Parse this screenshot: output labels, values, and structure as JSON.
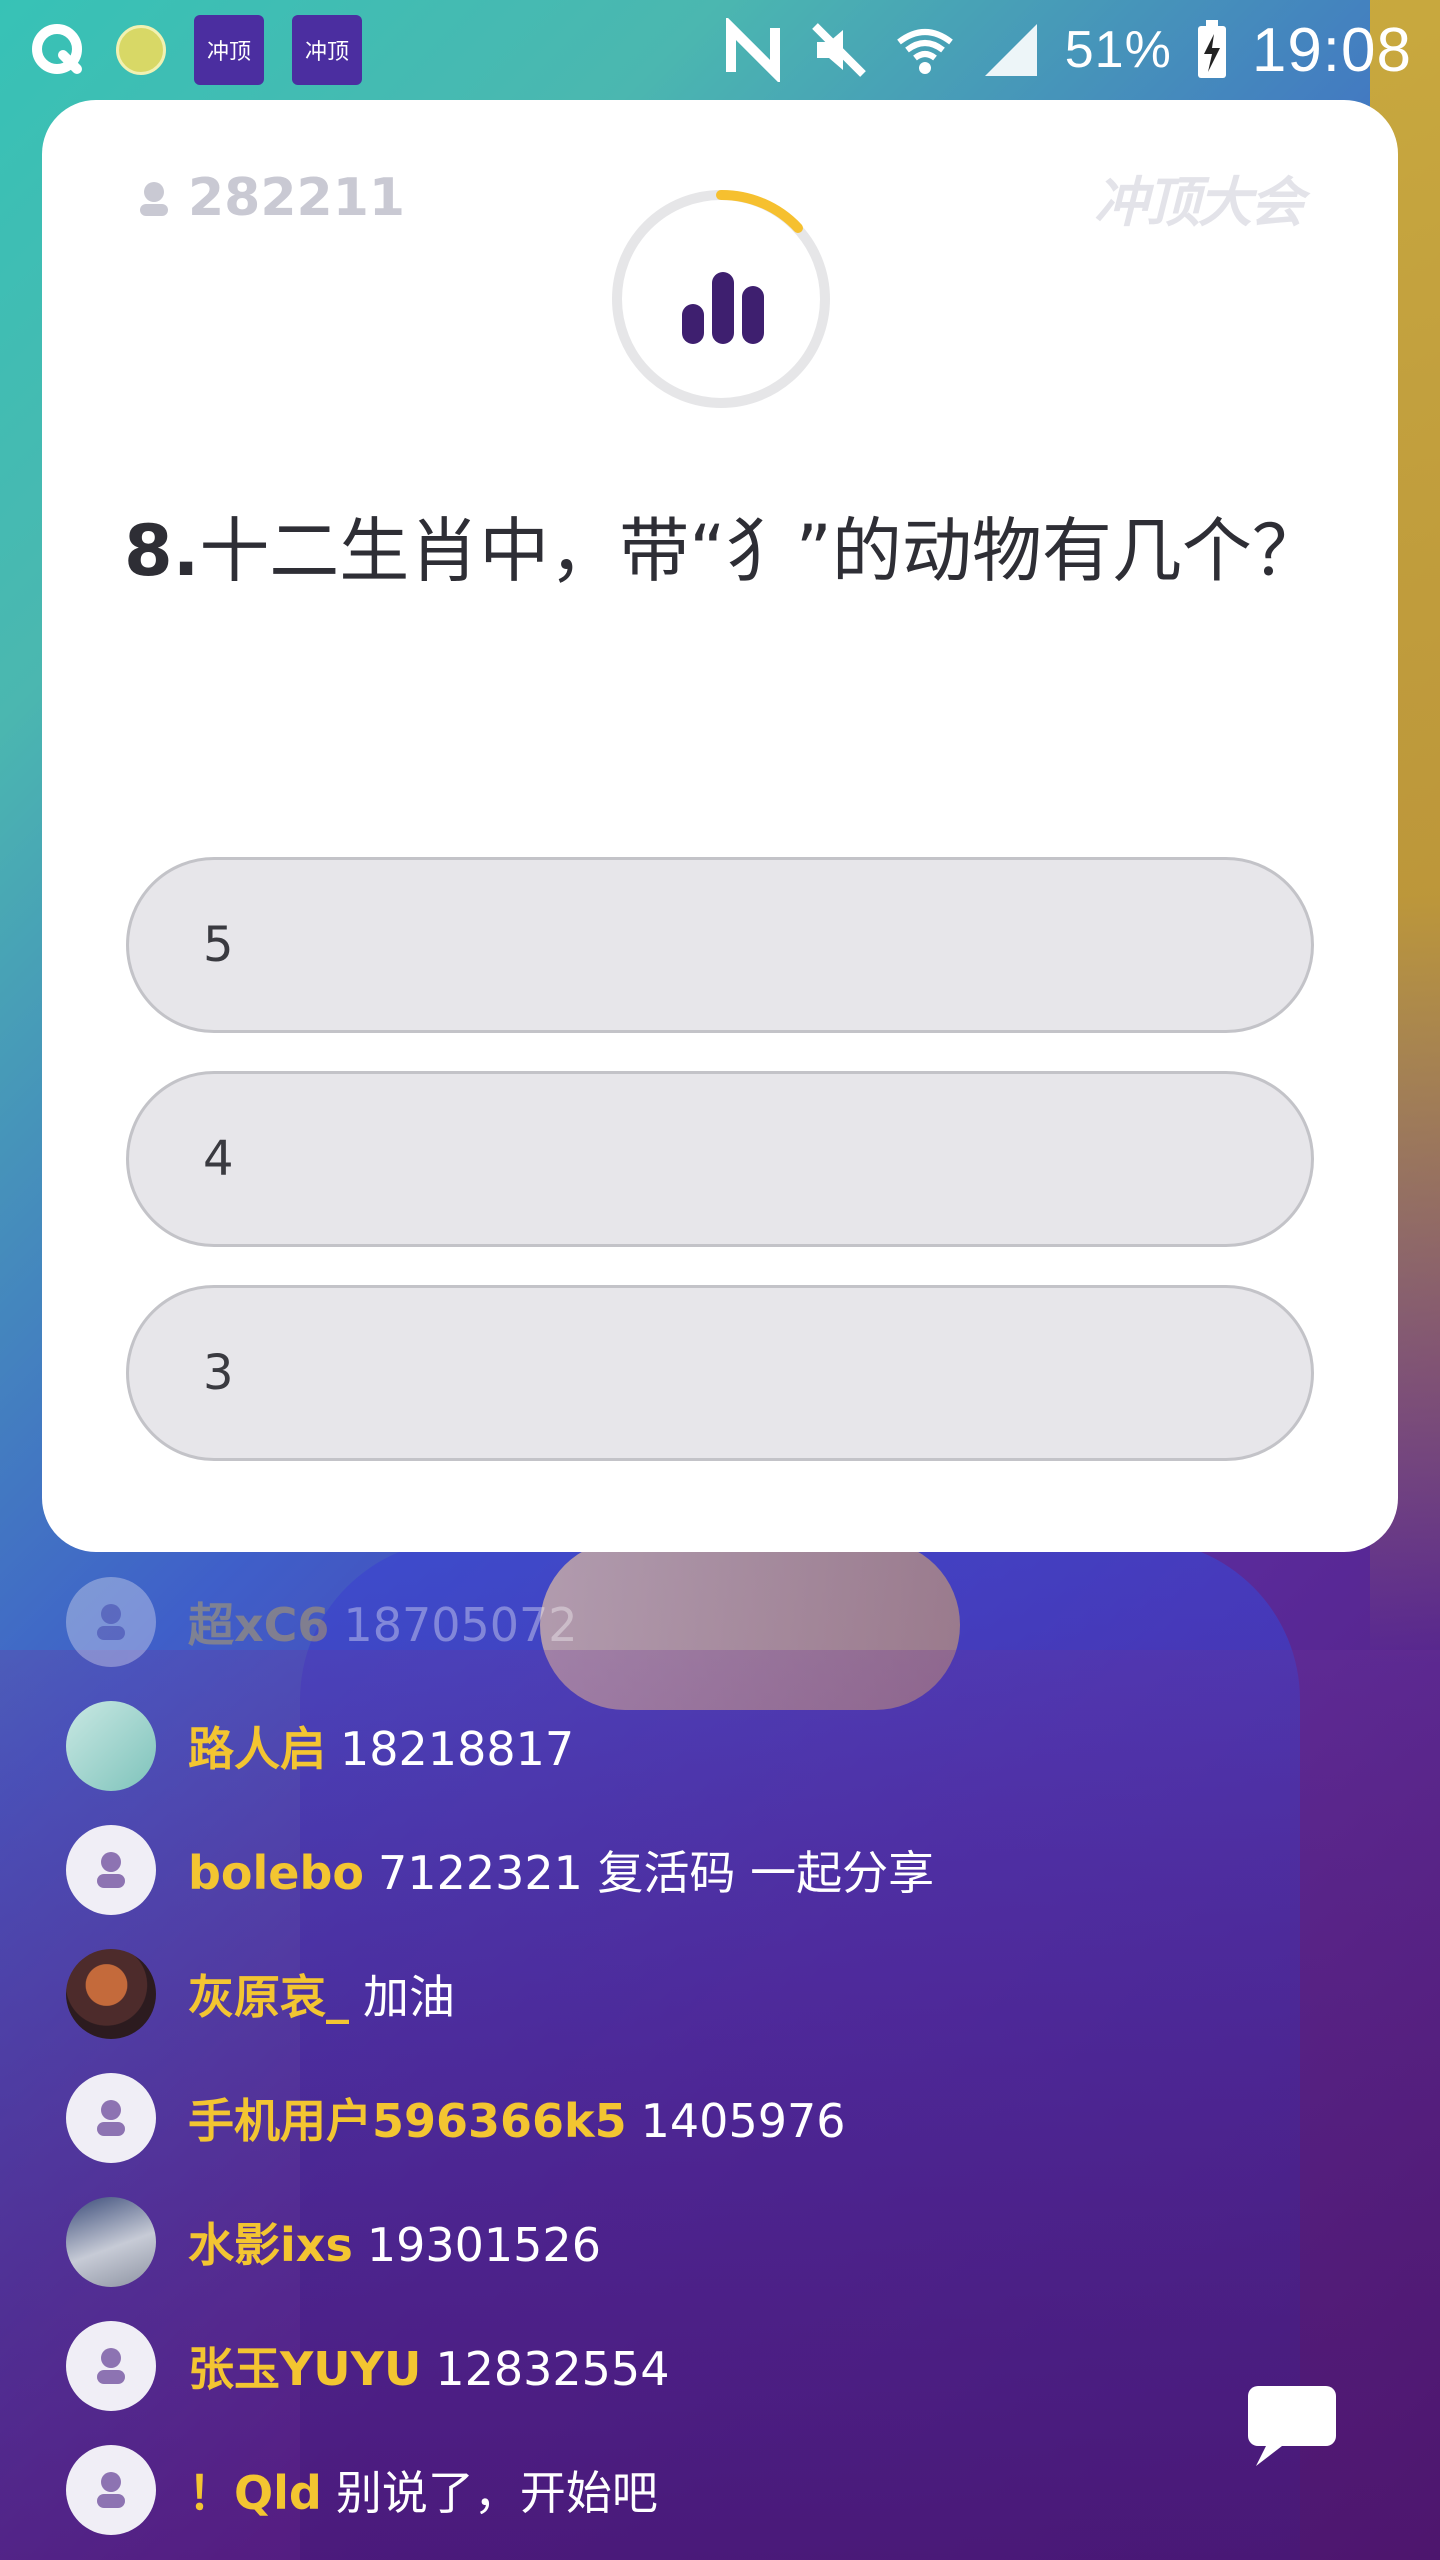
{
  "status_bar": {
    "app_icon_1": "冲顶",
    "app_icon_2": "冲顶",
    "battery": "51%",
    "time": "19:08",
    "icons": [
      "q-icon",
      "dot-icon",
      "app-icon",
      "app-icon",
      "nfc-icon",
      "mute-icon",
      "wifi-icon",
      "signal-icon",
      "battery-charging-icon"
    ]
  },
  "card": {
    "viewer_count": "282211",
    "logo_text": "冲顶大会",
    "question_number": "8.",
    "question_text": "十二生肖中，带“犭”的动物有几个？",
    "options": [
      "5",
      "4",
      "3"
    ]
  },
  "chat": [
    {
      "name": "超xC6",
      "text": "18705072",
      "avatar": "default",
      "faded": true
    },
    {
      "name": "路人启",
      "text": "18218817",
      "avatar": "photo1",
      "faded": false
    },
    {
      "name": "bolebo",
      "text": "7122321  复活码  一起分享",
      "avatar": "default",
      "faded": false
    },
    {
      "name": "灰原哀_",
      "text": "加油",
      "avatar": "photo2",
      "faded": false
    },
    {
      "name": "手机用户596366k5",
      "text": "1405976",
      "avatar": "default",
      "faded": false
    },
    {
      "name": "水影ixs",
      "text": "19301526",
      "avatar": "photo3",
      "faded": false
    },
    {
      "name": "张玉YUYU",
      "text": "12832554",
      "avatar": "default",
      "faded": false
    },
    {
      "name": "！Qld",
      "text": "别说了，开始吧",
      "avatar": "default",
      "faded": false
    }
  ],
  "colors": {
    "accent_gold": "#f3c531",
    "timer_ring": "#e6e6e8",
    "timer_progress": "#f6c02f",
    "bars": "#3e1f6f"
  }
}
